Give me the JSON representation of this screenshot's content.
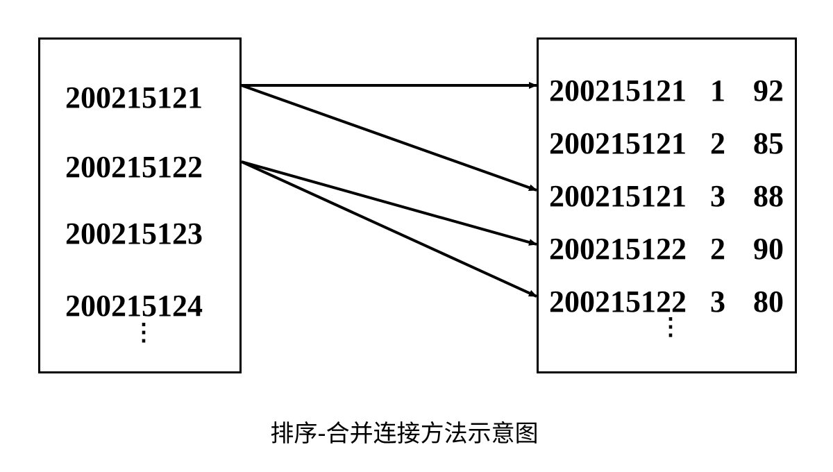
{
  "left_table": {
    "rows": [
      "200215121",
      "200215122",
      "200215123",
      "200215124"
    ],
    "continuation": "⋮"
  },
  "right_table": {
    "rows": [
      {
        "id": "200215121",
        "course": "1",
        "grade": "92"
      },
      {
        "id": "200215121",
        "course": "2",
        "grade": "85"
      },
      {
        "id": "200215121",
        "course": "3",
        "grade": "88"
      },
      {
        "id": "200215122",
        "course": "2",
        "grade": "90"
      },
      {
        "id": "200215122",
        "course": "3",
        "grade": "80"
      }
    ],
    "continuation": "⋮"
  },
  "links": [
    {
      "from": 0,
      "to": 0
    },
    {
      "from": 0,
      "to": 2
    },
    {
      "from": 1,
      "to": 3
    },
    {
      "from": 1,
      "to": 4
    }
  ],
  "caption": "排序-合并连接方法示意图"
}
